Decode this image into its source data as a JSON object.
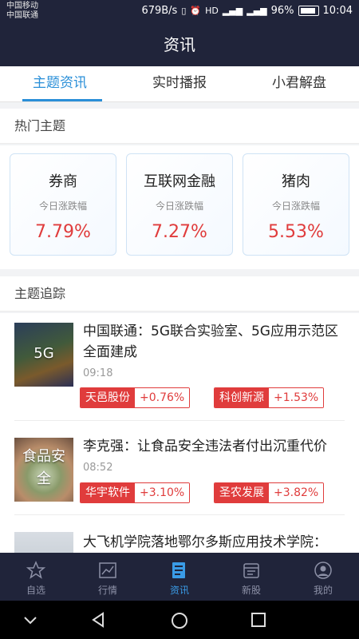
{
  "status_bar": {
    "carrier1": "中国移动",
    "carrier2": "中国联通",
    "speed": "679B/s",
    "battery": "96%",
    "time": "10:04"
  },
  "header": {
    "title": "资讯"
  },
  "tabs": [
    {
      "label": "主题资讯",
      "active": true
    },
    {
      "label": "实时播报",
      "active": false
    },
    {
      "label": "小君解盘",
      "active": false
    }
  ],
  "hot": {
    "heading": "热门主题",
    "cards": [
      {
        "name": "券商",
        "sub": "今日涨跌幅",
        "value": "7.79%"
      },
      {
        "name": "互联网金融",
        "sub": "今日涨跌幅",
        "value": "7.27%"
      },
      {
        "name": "猪肉",
        "sub": "今日涨跌幅",
        "value": "5.53%"
      }
    ]
  },
  "tracking": {
    "heading": "主题追踪",
    "items": [
      {
        "thumb_text": "5G",
        "title": "中国联通：5G联合实验室、5G应用示范区全面建成",
        "time": "09:18",
        "tags": [
          {
            "name": "天邑股份",
            "change": "+0.76%"
          },
          {
            "name": "科创新源",
            "change": "+1.53%"
          }
        ]
      },
      {
        "thumb_text": "食品安全",
        "title": "李克强：让食品安全违法者付出沉重代价",
        "time": "08:52",
        "tags": [
          {
            "name": "华宇软件",
            "change": "+3.10%"
          },
          {
            "name": "圣农发展",
            "change": "+3.82%"
          }
        ]
      },
      {
        "thumb_text": "",
        "title": "大飞机学院落地鄂尔多斯应用技术学院：",
        "time": "",
        "tags": []
      }
    ]
  },
  "bottom_nav": [
    {
      "label": "自选",
      "icon": "star-icon",
      "active": false
    },
    {
      "label": "行情",
      "icon": "chart-icon",
      "active": false
    },
    {
      "label": "资讯",
      "icon": "news-icon",
      "active": true
    },
    {
      "label": "新股",
      "icon": "calendar-icon",
      "active": false
    },
    {
      "label": "我的",
      "icon": "user-icon",
      "active": false
    }
  ],
  "colors": {
    "header_bg": "#20243a",
    "accent": "#2a8fd8",
    "up_red": "#e03c3c"
  }
}
